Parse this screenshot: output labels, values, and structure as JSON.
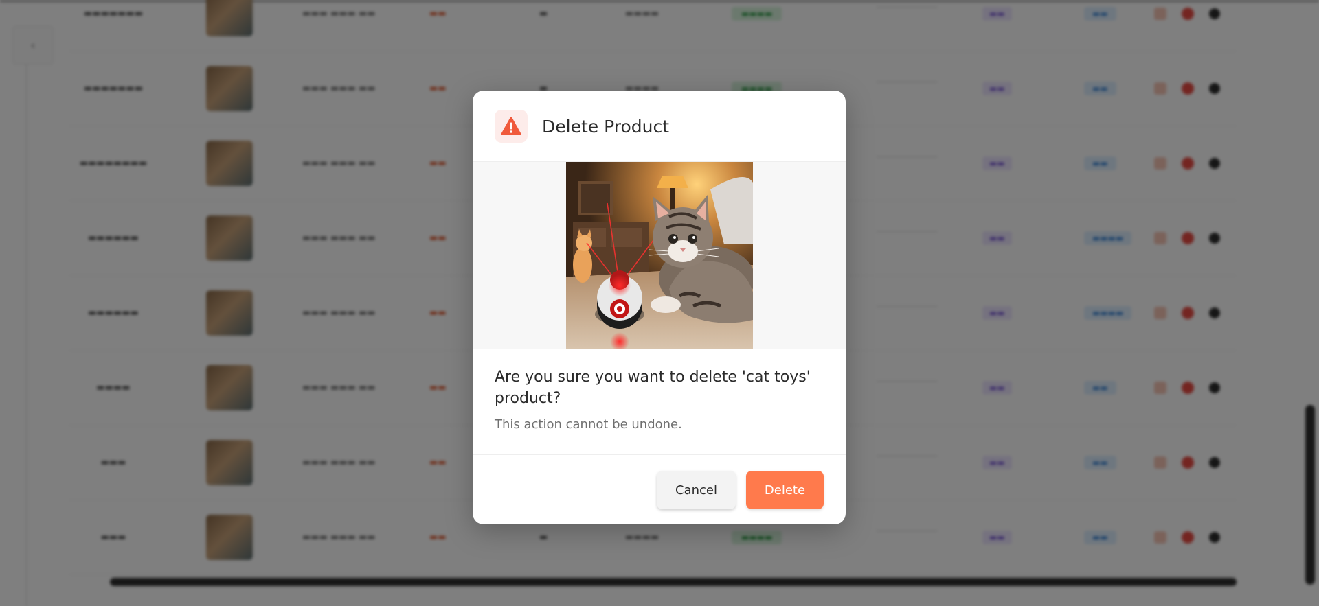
{
  "modal": {
    "title": "Delete Product",
    "icon": "warning-icon",
    "image_subject": "cat toys",
    "question": "Are you sure you want to delete 'cat toys' product?",
    "note": "This action cannot be undone.",
    "cancel_label": "Cancel",
    "delete_label": "Delete",
    "colors": {
      "accent": "#ff7a4c",
      "warning": "#f05a3c",
      "overlay": "rgba(0,0,0,0.5)"
    }
  },
  "background": {
    "collapse_icon": "chevron-left-icon",
    "rows": 8,
    "action_icons": [
      "edit-icon",
      "delete-icon",
      "more-icon"
    ]
  }
}
